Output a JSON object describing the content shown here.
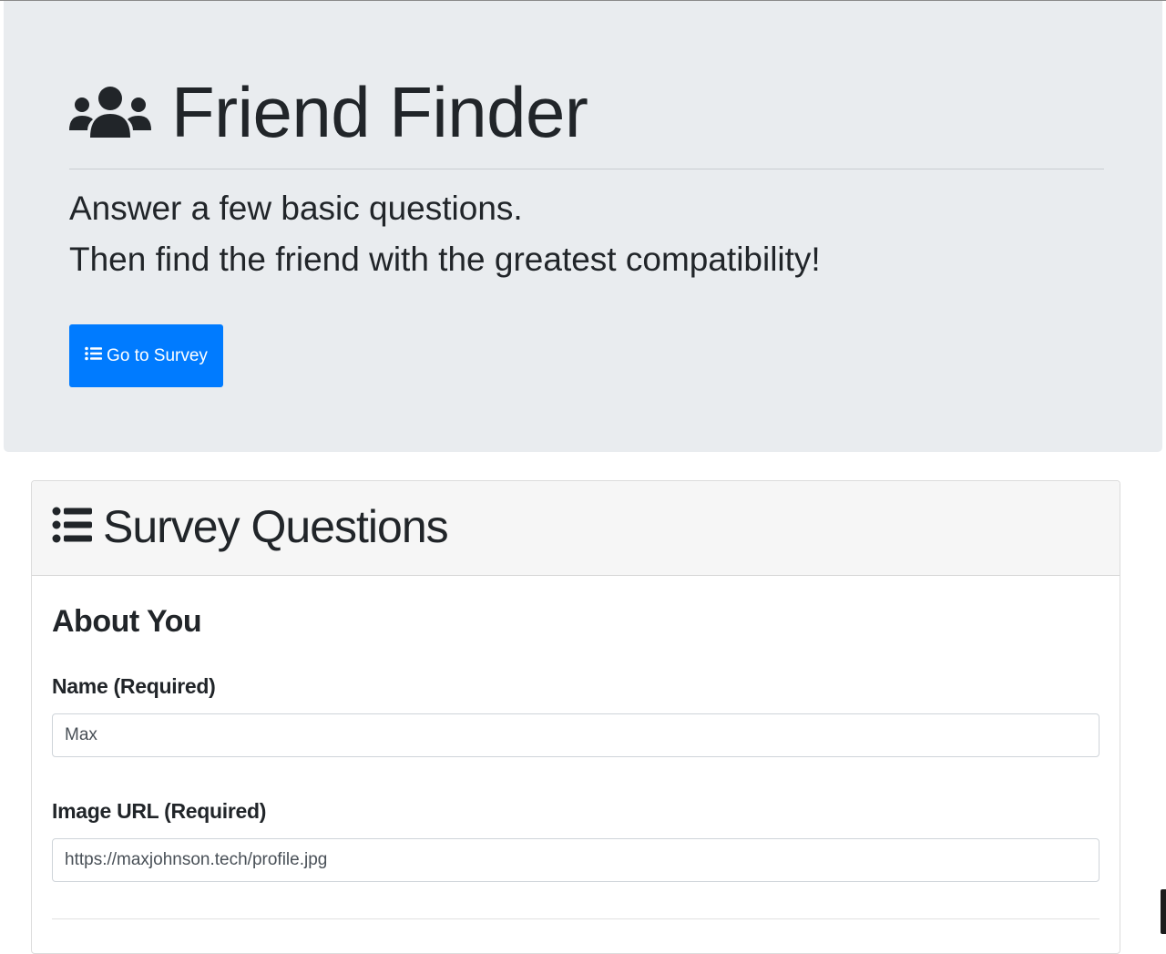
{
  "jumbotron": {
    "title": "Friend Finder",
    "title_icon": "users-icon",
    "lead_line1": "Answer a few basic questions.",
    "lead_line2": "Then find the friend with the greatest compatibility!",
    "button_label": "Go to Survey",
    "button_icon": "list-icon",
    "background_color": "#e9ecef",
    "button_color": "#007bff"
  },
  "survey": {
    "header_title": "Survey Questions",
    "header_icon": "list-icon",
    "section_title": "About You",
    "name_label": "Name (Required)",
    "name_value": "Max",
    "image_label": "Image URL (Required)",
    "image_value": "https://maxjohnson.tech/profile.jpg"
  }
}
